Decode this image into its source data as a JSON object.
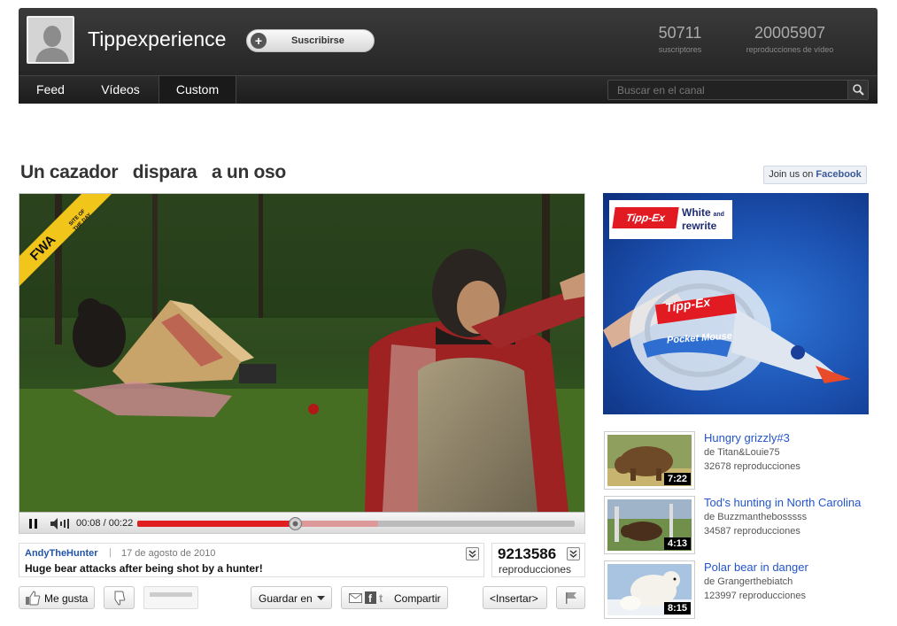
{
  "header": {
    "channel_title": "Tippexperience",
    "subscribe_label": "Suscribirse",
    "stats": [
      {
        "value": "50711",
        "label": "suscriptores"
      },
      {
        "value": "20005907",
        "label": "reproducciones de vídeo"
      }
    ]
  },
  "nav": {
    "tabs": [
      {
        "label": "Feed",
        "active": false
      },
      {
        "label": "Vídeos",
        "active": false
      },
      {
        "label": "Custom",
        "active": true
      }
    ],
    "search_placeholder": "Buscar en el canal"
  },
  "video": {
    "title": "Un cazador   dispara   a un oso",
    "badge": {
      "logo": "FWA",
      "text": "SITE OF THE DAY"
    },
    "current_time": "00:08",
    "duration": "00:22",
    "time_display": "00:08 / 00:22",
    "played_fraction": 0.36,
    "buffered_fraction": 0.55,
    "uploader": "AndyTheHunter",
    "upload_date": "17 de agosto de 2010",
    "description": "Huge bear attacks after being shot by a hunter!",
    "views": "9213586",
    "views_label": "reproducciones",
    "rating_fraction": 0.0
  },
  "facebook": {
    "prefix": "Join us on ",
    "brand": "Facebook"
  },
  "actions": {
    "like_label": "Me gusta",
    "save_label": "Guardar en",
    "share_label": "Compartir",
    "embed_label": "<Insertar>"
  },
  "ad": {
    "brand": "Tipp-Ex",
    "tagline_1": "White",
    "tagline_and": "and",
    "tagline_2": "rewrite",
    "product_brand": "Tipp-Ex",
    "product_name": "Pocket Mouse"
  },
  "related": [
    {
      "title": "Hungry grizzly#3",
      "author": "de Titan&Louie75",
      "views": "32678 reproducciones",
      "duration": "7:22"
    },
    {
      "title": "Tod's hunting in North Carolina",
      "author": "de Buzzmanthebosssss",
      "views": "34587 reproducciones",
      "duration": "4:13"
    },
    {
      "title": "Polar bear in danger",
      "author": "de Grangerthebiatch",
      "views": "123997 reproducciones",
      "duration": "8:15"
    }
  ],
  "colors": {
    "header_bg": "#2f2f2f",
    "progress_played": "#e02020",
    "link_blue": "#2255cc",
    "facebook_blue": "#3b5998",
    "ad_blue": "#1b4fae",
    "ad_red": "#e21b23"
  }
}
